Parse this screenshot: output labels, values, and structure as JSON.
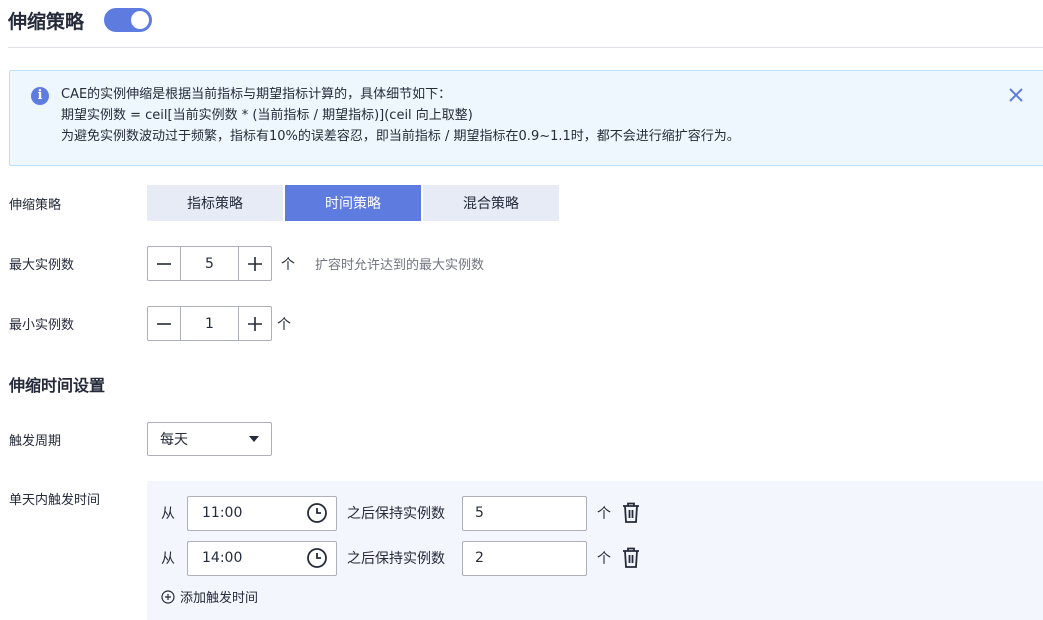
{
  "header": {
    "title": "伸缩策略",
    "toggle_on": true
  },
  "alert": {
    "line1": "CAE的实例伸缩是根据当前指标与期望指标计算的，具体细节如下：",
    "line2": "期望实例数 = ceil[当前实例数 * (当前指标 / 期望指标)](ceil 向上取整)",
    "line3": "为避免实例数波动过于频繁，指标有10%的误差容忍，即当前指标 / 期望指标在0.9~1.1时，都不会进行缩扩容行为。"
  },
  "policy": {
    "label": "伸缩策略",
    "options": [
      "指标策略",
      "时间策略",
      "混合策略"
    ],
    "selected": "时间策略"
  },
  "max_instances": {
    "label": "最大实例数",
    "value": "5",
    "unit": "个",
    "hint": "扩容时允许达到的最大实例数"
  },
  "min_instances": {
    "label": "最小实例数",
    "value": "1",
    "unit": "个"
  },
  "schedule": {
    "section_title": "伸缩时间设置",
    "period_label": "触发周期",
    "period_value": "每天",
    "triggers_label": "单天内触发时间",
    "triggers": [
      {
        "from": "从",
        "time": "11:00",
        "keep_label": "之后保持实例数",
        "count": "5",
        "unit": "个"
      },
      {
        "from": "从",
        "time": "14:00",
        "keep_label": "之后保持实例数",
        "count": "2",
        "unit": "个"
      }
    ],
    "add_label": "添加触发时间"
  },
  "colors": {
    "accent": "#5e7ce0",
    "alert_bg": "#eef7fd",
    "panel_bg": "#f3f6fc"
  }
}
